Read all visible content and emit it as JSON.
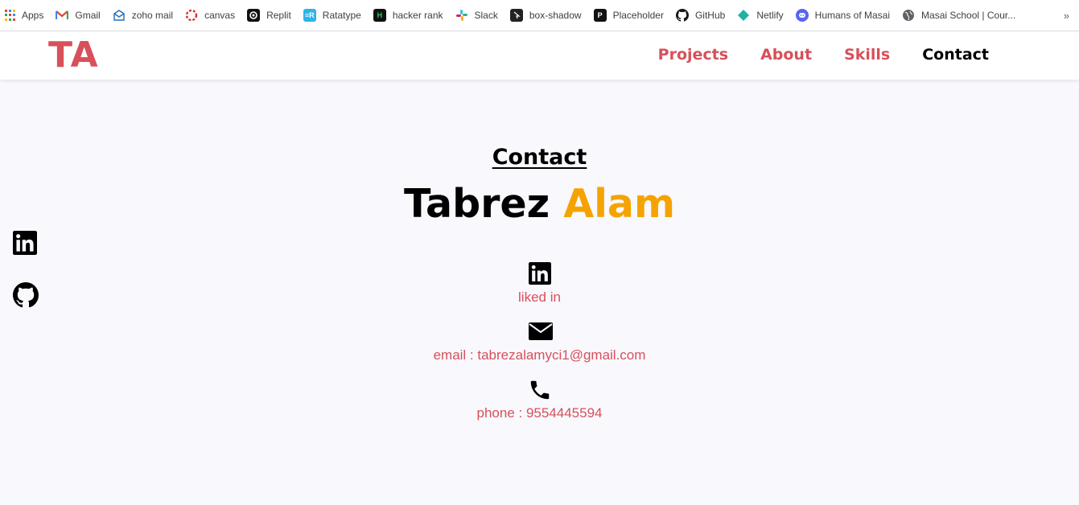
{
  "bookmarks": {
    "items": [
      {
        "label": "Apps",
        "icon": "apps-grid-icon"
      },
      {
        "label": "Gmail",
        "icon": "gmail-icon"
      },
      {
        "label": "zoho mail",
        "icon": "zoho-mail-icon"
      },
      {
        "label": "canvas",
        "icon": "canvas-icon"
      },
      {
        "label": "Replit",
        "icon": "replit-icon"
      },
      {
        "label": "Ratatype",
        "icon": "ratatype-icon"
      },
      {
        "label": "hacker rank",
        "icon": "hackerrank-icon"
      },
      {
        "label": "Slack",
        "icon": "slack-icon"
      },
      {
        "label": "box-shadow",
        "icon": "box-shadow-icon"
      },
      {
        "label": "Placeholder",
        "icon": "placeholder-icon"
      },
      {
        "label": "GitHub",
        "icon": "github-icon"
      },
      {
        "label": "Netlify",
        "icon": "netlify-icon"
      },
      {
        "label": "Humans of Masai",
        "icon": "discord-icon"
      },
      {
        "label": "Masai School | Cour...",
        "icon": "globe-icon"
      }
    ],
    "overflow": "»"
  },
  "navbar": {
    "logo": "TA",
    "links": [
      {
        "label": "Projects",
        "color": "#d7505a"
      },
      {
        "label": "About",
        "color": "#d7505a"
      },
      {
        "label": "Skills",
        "color": "#d7505a"
      },
      {
        "label": "Contact",
        "color": "#000000"
      }
    ]
  },
  "side_social": [
    "linkedin-icon",
    "github-icon"
  ],
  "contact": {
    "heading": "Contact",
    "first_name": "Tabrez",
    "last_name": "Alam",
    "items": [
      {
        "icon": "linkedin-icon",
        "label": "liked in"
      },
      {
        "icon": "envelope-icon",
        "label": "email : tabrezalamyci1@gmail.com"
      },
      {
        "icon": "phone-icon",
        "label": "phone : 9554445594"
      }
    ]
  },
  "colors": {
    "accent": "#d7505a",
    "highlight": "#f5a300",
    "page_background": "#f8f8fd"
  }
}
